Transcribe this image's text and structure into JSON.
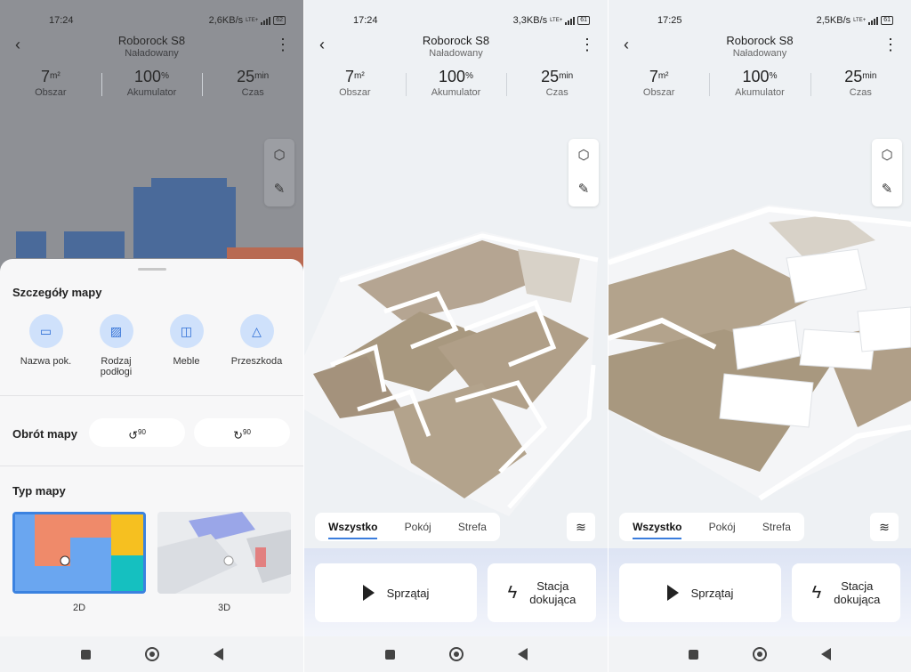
{
  "colors": {
    "accent": "#3b7ddd",
    "bg": "#eef1f4",
    "overlay": "#8e9095"
  },
  "screens": [
    {
      "time": "17:24",
      "speed": "2,6KB/s",
      "battery": "62"
    },
    {
      "time": "17:24",
      "speed": "3,3KB/s",
      "battery": "61"
    },
    {
      "time": "17:25",
      "speed": "2,5KB/s",
      "battery": "61"
    }
  ],
  "status_lte": "LTE+",
  "header": {
    "title": "Roborock S8",
    "subtitle": "Naładowany"
  },
  "stats": {
    "area": {
      "value": "7",
      "unit": "m²",
      "label": "Obszar"
    },
    "battery": {
      "value": "100",
      "unit": "%",
      "label": "Akumulator"
    },
    "time": {
      "value": "25",
      "unit": "min",
      "label": "Czas"
    }
  },
  "icons": {
    "back": "back-arrow-icon",
    "more": "more-vert-icon",
    "cube": "cube-3d-icon",
    "edit": "map-edit-icon",
    "layers": "layers-icon",
    "play": "play-icon",
    "dock": "lightning-icon"
  },
  "tabs": [
    "Wszystko",
    "Pokój",
    "Strefa"
  ],
  "actions": {
    "clean": "Sprzątaj",
    "dock_line1": "Stacja",
    "dock_line2": "dokująca"
  },
  "sheet": {
    "details_title": "Szczegóły mapy",
    "details": [
      {
        "label": "Nazwa pok.",
        "icon": "room-name-icon"
      },
      {
        "label": "Rodzaj podłogi",
        "icon": "floor-type-icon"
      },
      {
        "label": "Meble",
        "icon": "furniture-icon"
      },
      {
        "label": "Przeszkoda",
        "icon": "obstacle-icon"
      }
    ],
    "rotate_title": "Obrót mapy",
    "rotate_left": "90",
    "rotate_right": "90",
    "maptype_title": "Typ mapy",
    "maptypes": [
      "2D",
      "3D"
    ],
    "selected_maptype": "2D"
  }
}
